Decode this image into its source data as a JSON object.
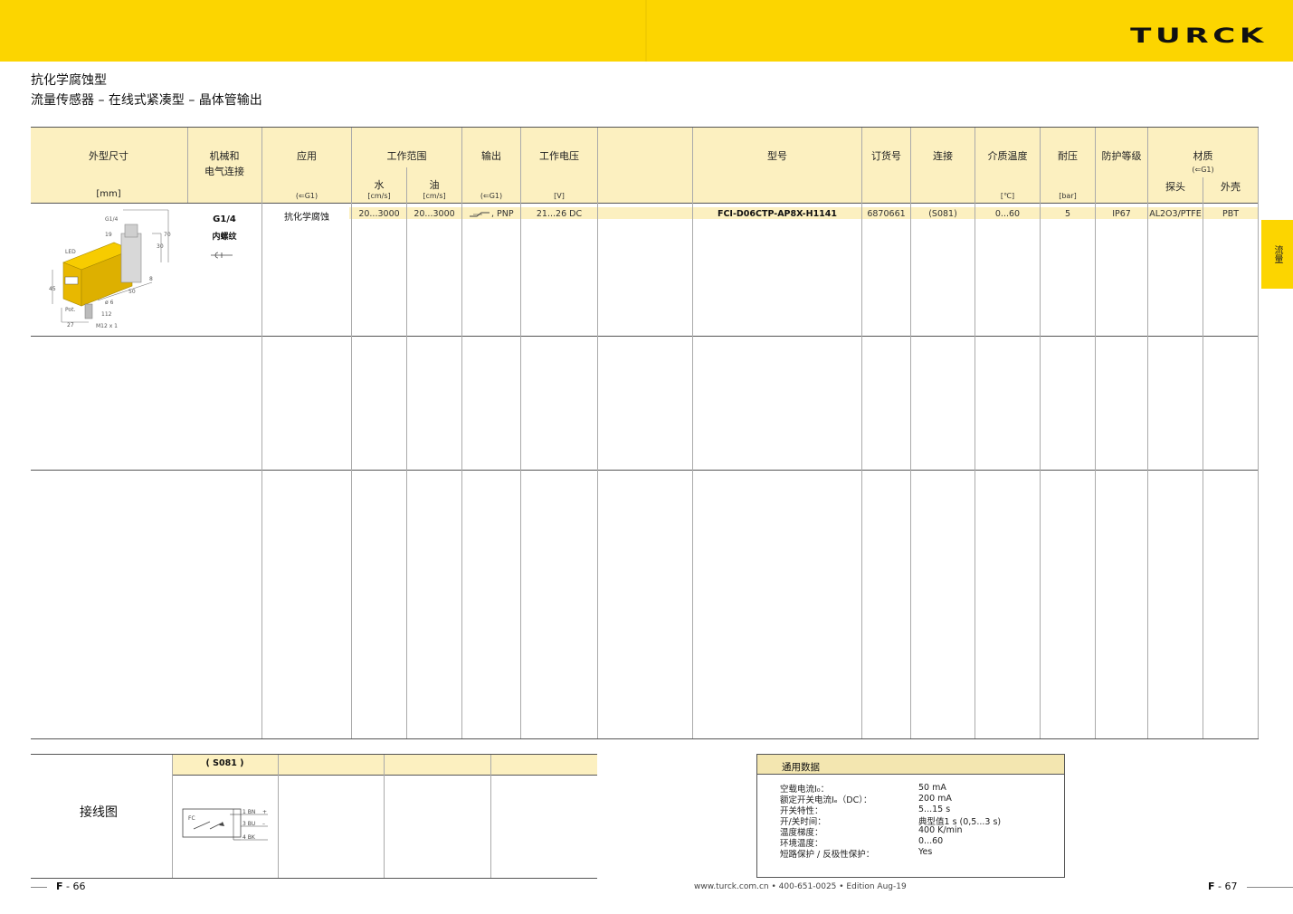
{
  "brand": "TURCK",
  "side_tab": "流量",
  "title": {
    "line1": "抗化学腐蚀型",
    "line2": "流量传感器 – 在线式紧凑型 – 晶体管输出"
  },
  "table": {
    "headers": {
      "dimensions": "外型尺寸",
      "dimensions_unit": "[mm]",
      "connection": "机械和\n电气连接",
      "application": "应用",
      "application_ref": "(⇐G1)",
      "range": "工作范围",
      "range_water": "水",
      "range_water_unit": "[cm/s]",
      "range_oil": "油",
      "range_oil_unit": "[cm/s]",
      "output": "输出",
      "output_ref": "(⇐G1)",
      "voltage": "工作电压",
      "voltage_unit": "[V]",
      "type": "型号",
      "ident": "订货号",
      "conn": "连接",
      "medium_temp": "介质温度",
      "medium_temp_unit": "[℃]",
      "pressure": "耐压",
      "pressure_unit": "[bar]",
      "protection": "防护等级",
      "material": "材质",
      "material_ref": "(⇐G1)",
      "material_probe": "探头",
      "material_housing": "外壳"
    },
    "row": {
      "thread": "G1/4",
      "thread_desc": "内螺纹",
      "application": "抗化学腐蚀",
      "water": "20...3000",
      "oil": "20...3000",
      "output": ", PNP",
      "voltage": "21...26 DC",
      "type": "FCI-D06CTP-AP8X-H1141",
      "ident": "6870661",
      "conn": "(S081)",
      "temp": "0...60",
      "pressure": "5",
      "protection": "IP67",
      "probe": "AL2O3/PTFE",
      "housing": "PBT"
    },
    "drawing": {
      "g14": "G1/4",
      "d19": "19",
      "d70": "70",
      "d30": "30",
      "led": "LED",
      "d45": "45",
      "d50": "50",
      "d8": "8",
      "d6": "ø 6",
      "pot": "Pot.",
      "d112": "112",
      "d27": "27",
      "m12": "M12 x 1"
    }
  },
  "wiring": {
    "label": "接线图",
    "col1": "( S081 )",
    "fc": "FC",
    "bn": "1 BN",
    "bu": "3 BU",
    "bk": "4 BK",
    "plus": "+",
    "minus": "–"
  },
  "general": {
    "title": "通用数据",
    "items": [
      {
        "label": "空载电流I₀：",
        "value": "50 mA"
      },
      {
        "label": "额定开关电流Iₑ（DC）：",
        "value": "200 mA"
      },
      {
        "label": "开关特性：",
        "value": ""
      },
      {
        "label": "开/关时间：",
        "value": "5...15 s"
      },
      {
        "label": "温度梯度：",
        "value": "典型值1 s (0,5...3 s)"
      },
      {
        "label": "环境温度：",
        "value": "400 K/min"
      },
      {
        "label": "短路保护 / 反极性保护：",
        "value": "0...60"
      },
      {
        "label": "",
        "value": "Yes"
      }
    ]
  },
  "footer": {
    "left_page_prefix": "F",
    "left_page_num": "- 66",
    "right_page_prefix": "F",
    "right_page_num": "- 67",
    "contact": "www.turck.com.cn • 400-651-0025 • Edition Aug-19"
  }
}
